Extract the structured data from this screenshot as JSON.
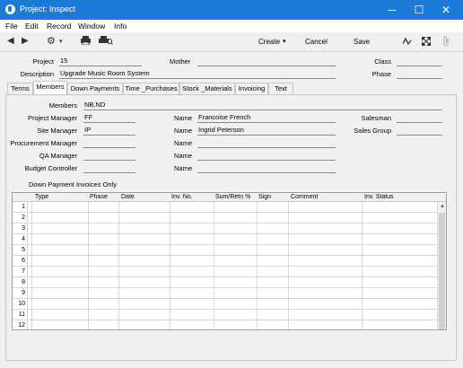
{
  "window": {
    "title": "Project: Inspect",
    "minimize": "─",
    "maximize": "☐",
    "close": "✕"
  },
  "menu": [
    "File",
    "Edit",
    "Record",
    "Window",
    "Info"
  ],
  "toolbar": {
    "create": "Create",
    "create_arrow": "▾",
    "cancel": "Cancel",
    "save": "Save"
  },
  "header": {
    "project_label": "Project",
    "project_value": "15",
    "mother_label": "Mother",
    "mother_value": "",
    "class_label": "Class",
    "class_value": "",
    "description_label": "Description",
    "description_value": "Upgrade Music Room System",
    "phase_label": "Phase",
    "phase_value": ""
  },
  "tabs": [
    "Terms",
    "Members",
    "Down Payments",
    "Time _Purchases",
    "Stock _Materials",
    "Invoicing",
    "Text"
  ],
  "members": {
    "members_label": "Members",
    "members_value": "NB,ND",
    "salesman_label": "Salesman",
    "sales_group_label": "Sales Group",
    "name_label": "Name",
    "rows": [
      {
        "label": "Project Manager",
        "code": "FF",
        "name": "Francoise French"
      },
      {
        "label": "Site Manager",
        "code": "IP",
        "name": "Ingrid Peterson"
      },
      {
        "label": "Procurement Manager",
        "code": "",
        "name": ""
      },
      {
        "label": "QA Manager",
        "code": "",
        "name": ""
      },
      {
        "label": "Budget Controller",
        "code": "",
        "name": ""
      }
    ]
  },
  "grid": {
    "caption": "Down Payment Invoices Only",
    "columns": [
      "Type",
      "Phase",
      "Date",
      "Inv. No.",
      "Sum/Retn %",
      "Sign",
      "Comment",
      "Inv. Status"
    ],
    "row_numbers": [
      "1",
      "2",
      "3",
      "4",
      "5",
      "6",
      "7",
      "8",
      "9",
      "10",
      "11",
      "12"
    ]
  }
}
